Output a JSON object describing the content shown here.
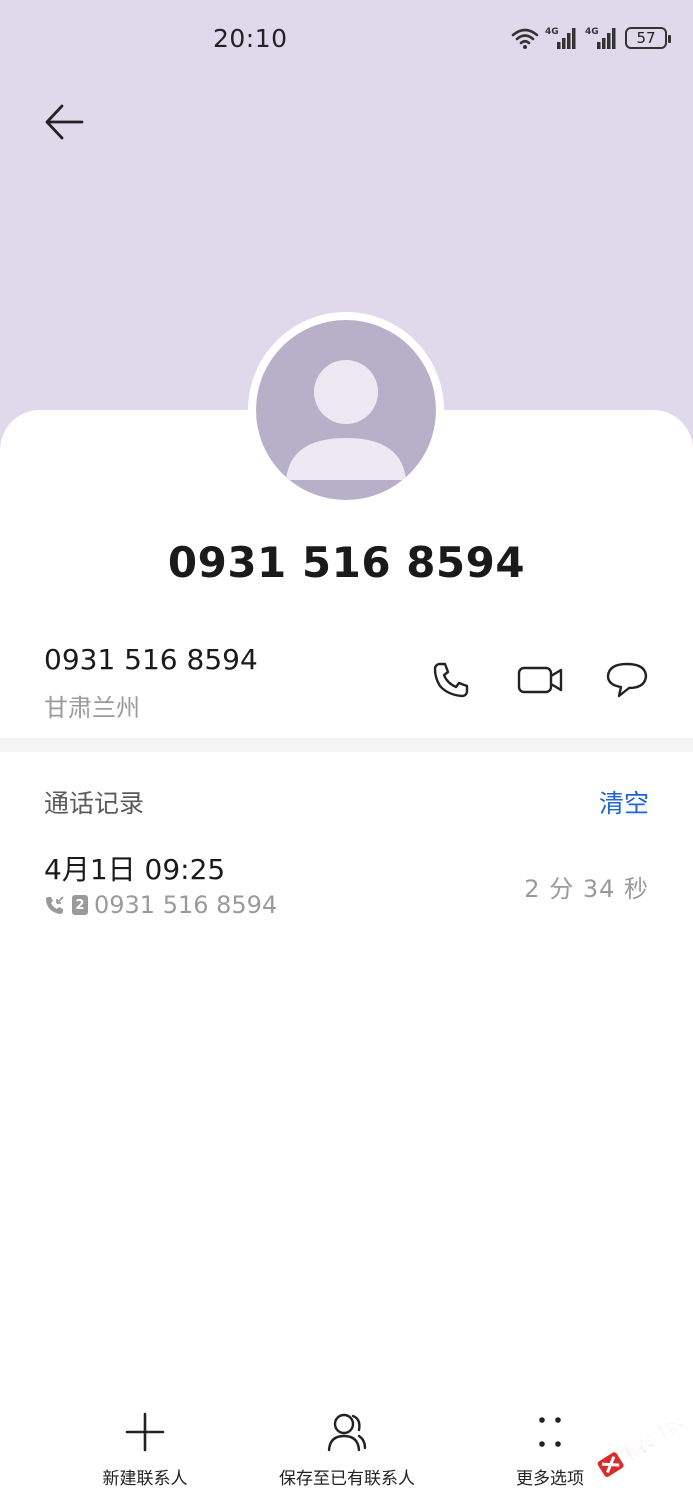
{
  "status_bar": {
    "time": "20:10",
    "battery": "57",
    "network_1": "4G",
    "network_2": "4G",
    "icons": [
      "wifi-icon",
      "signal-icon",
      "signal-icon",
      "battery-icon"
    ]
  },
  "header": {
    "back_icon": "arrow-left-icon"
  },
  "contact": {
    "title": "0931 516 8594",
    "avatar_icon": "person-silhouette-icon"
  },
  "number_row": {
    "number": "0931 516 8594",
    "location": "甘肃兰州",
    "actions": [
      "phone-icon",
      "video-call-icon",
      "message-icon"
    ]
  },
  "call_log": {
    "header": "通话记录",
    "clear_label": "清空",
    "entries": [
      {
        "date": "4月1日 09:25",
        "sim": "2",
        "number": "0931 516 8594",
        "duration": "2 分 34 秒"
      }
    ]
  },
  "bottom_bar": {
    "items": [
      {
        "label": "新建联系人",
        "icon": "plus-icon"
      },
      {
        "label": "保存至已有联系人",
        "icon": "person-icon"
      },
      {
        "label": "更多选项",
        "icon": "more-dots-icon"
      }
    ]
  },
  "watermark": {
    "text": "卡农社区"
  },
  "colors": {
    "header_bg": "#e0d9ec",
    "avatar_bg": "#b8b0c9",
    "accent": "#1e64d2"
  }
}
